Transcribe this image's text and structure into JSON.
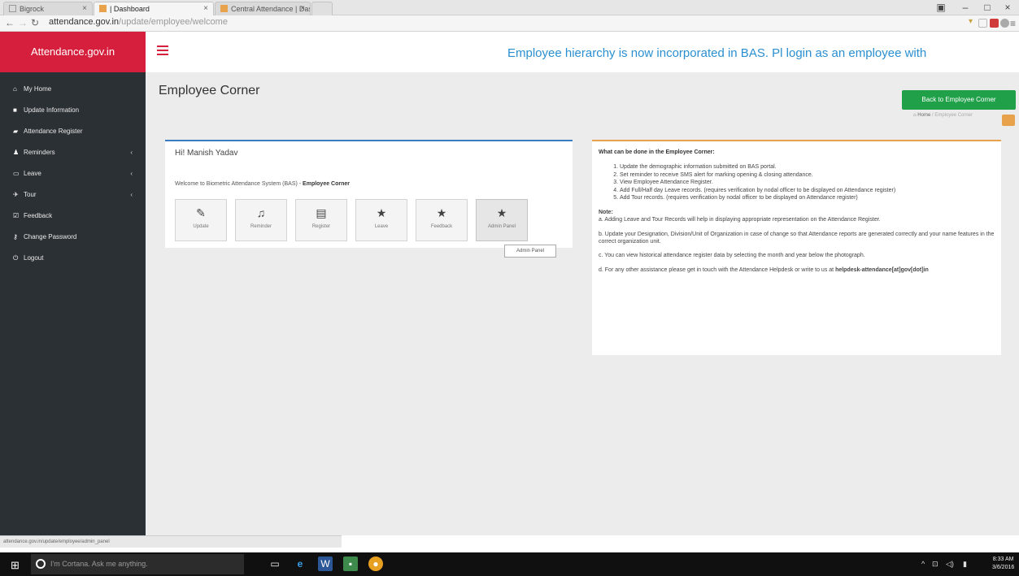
{
  "browser": {
    "tabs": [
      {
        "label": "Bigrock",
        "active": false
      },
      {
        "label": "| Dashboard",
        "active": true
      },
      {
        "label": "Central Attendance | Dash",
        "active": false
      }
    ],
    "url_host": "attendance.gov.in",
    "url_path": "/update/employee/welcome",
    "back_icon": "arrow-left-icon",
    "forward_icon": "arrow-right-icon",
    "reload_icon": "reload-icon",
    "status_url": "attendance.gov.in/update/employee/admin_panel"
  },
  "app": {
    "brand": "Attendance.gov.in",
    "marquee": "Employee hierarchy is now incorporated in BAS. Pl login as an employee with",
    "accent": "#d51f3c"
  },
  "sidebar": {
    "items": [
      {
        "label": "My Home",
        "icon": "home-icon",
        "has_arrow": false
      },
      {
        "label": "Update Information",
        "icon": "pencil-square-icon",
        "has_arrow": false
      },
      {
        "label": "Attendance Register",
        "icon": "book-icon",
        "has_arrow": false
      },
      {
        "label": "Reminders",
        "icon": "user-icon",
        "has_arrow": true
      },
      {
        "label": "Leave",
        "icon": "calendar-icon",
        "has_arrow": true
      },
      {
        "label": "Tour",
        "icon": "plane-icon",
        "has_arrow": true
      },
      {
        "label": "Feedback",
        "icon": "feedback-icon",
        "has_arrow": false
      },
      {
        "label": "Change Password",
        "icon": "key-icon",
        "has_arrow": false
      },
      {
        "label": "Logout",
        "icon": "power-icon",
        "has_arrow": false
      }
    ]
  },
  "page": {
    "title": "Employee Corner",
    "back_button": "Back to Employee Corner",
    "breadcrumb": [
      "Home",
      "Employee Corner"
    ]
  },
  "left_panel": {
    "greeting": "Hi! Manish Yadav",
    "welcome_prefix": "Welcome to Biometric Attendance System (BAS) -",
    "welcome_bold": "Employee Corner",
    "tiles": [
      {
        "label": "Update",
        "icon": "edit-icon"
      },
      {
        "label": "Reminder",
        "icon": "bell-icon"
      },
      {
        "label": "Register",
        "icon": "book-icon"
      },
      {
        "label": "Leave",
        "icon": "star-icon"
      },
      {
        "label": "Feedback",
        "icon": "star-icon"
      },
      {
        "label": "Admin Panel",
        "icon": "star-icon"
      }
    ],
    "tooltip": "Admin Panel"
  },
  "right_panel": {
    "heading": "What can be done in the Employee Corner:",
    "steps": [
      "Update the demographic information submitted on BAS portal.",
      "Set reminder to receive SMS alert for marking opening & closing attendance.",
      "View Employee Attendance Register.",
      "Add Full/Half day Leave records. (requires verification by nodal officer to be displayed on Attendance register)",
      "Add Tour records. (requires verification by nodal officer to be displayed on Attendance register)"
    ],
    "note_heading": "Note:",
    "notes": [
      "a. Adding Leave and Tour Records will help in displaying appropriate representation on the Attendance Register.",
      "b. Update your Designation, Division/Unit of Organization in case of change so that Attendance reports are generated correctly and your name features in the correct organization unit.",
      "c. You can view historical attendance register data by selecting the month and year below the photograph.",
      "d. For any other assistance please get in touch with the Attendance Helpdesk or write to us at"
    ],
    "helpdesk_email": "helpdesk-attendance[at]gov[dot]in"
  },
  "taskbar": {
    "search_placeholder": "I'm Cortana. Ask me anything.",
    "time": "8:33 AM",
    "date": "3/6/2016"
  }
}
